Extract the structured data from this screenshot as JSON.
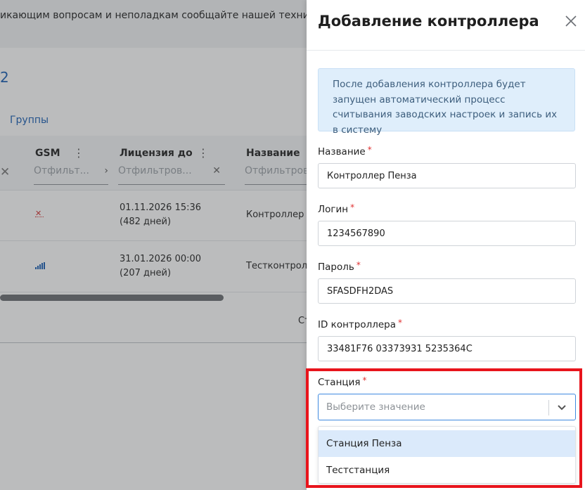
{
  "background": {
    "notice_text": "икающим вопросам и неполадкам сообщайте нашей техническо",
    "page_glyph": "2",
    "groups_tab": "Группы",
    "columns": [
      {
        "title": "GSM",
        "filter": "Отфильт...",
        "filter_suffix": "›"
      },
      {
        "title": "Лицензия до",
        "filter": "Отфильтров...",
        "filter_suffix": "✕"
      },
      {
        "title": "Название",
        "filter": "Отфильтров"
      }
    ],
    "rows": [
      {
        "gsm_icon": "gsm-error-icon",
        "license_date": "01.11.2026 15:36",
        "license_days": "(482 дней)",
        "name": "Контроллер"
      },
      {
        "gsm_icon": "gsm-signal-icon",
        "license_date": "31.01.2026 00:00",
        "license_days": "(207 дней)",
        "name": "Тестконтролл"
      }
    ],
    "footer_text": "Ст"
  },
  "drawer": {
    "title": "Добавление контроллера",
    "info": "После добавления контроллера будет запущен автоматический процесс считывания заводских настроек и запись их в систему",
    "fields": {
      "name": {
        "label": "Название",
        "value": "Контроллер Пенза"
      },
      "login": {
        "label": "Логин",
        "value": "1234567890"
      },
      "password": {
        "label": "Пароль",
        "value": "SFASDFH2DAS"
      },
      "controller_id": {
        "label": "ID контроллера",
        "value": "33481F76 03373931 5235364C"
      },
      "station": {
        "label": "Станция",
        "placeholder": "Выберите значение",
        "options": [
          "Станция Пенза",
          "Тестстанция"
        ]
      }
    },
    "required_mark": "*"
  },
  "colors": {
    "accent": "#3f8ae0",
    "info_bg": "#dfeefb",
    "required": "#e03131",
    "highlight": "#e8141c"
  }
}
